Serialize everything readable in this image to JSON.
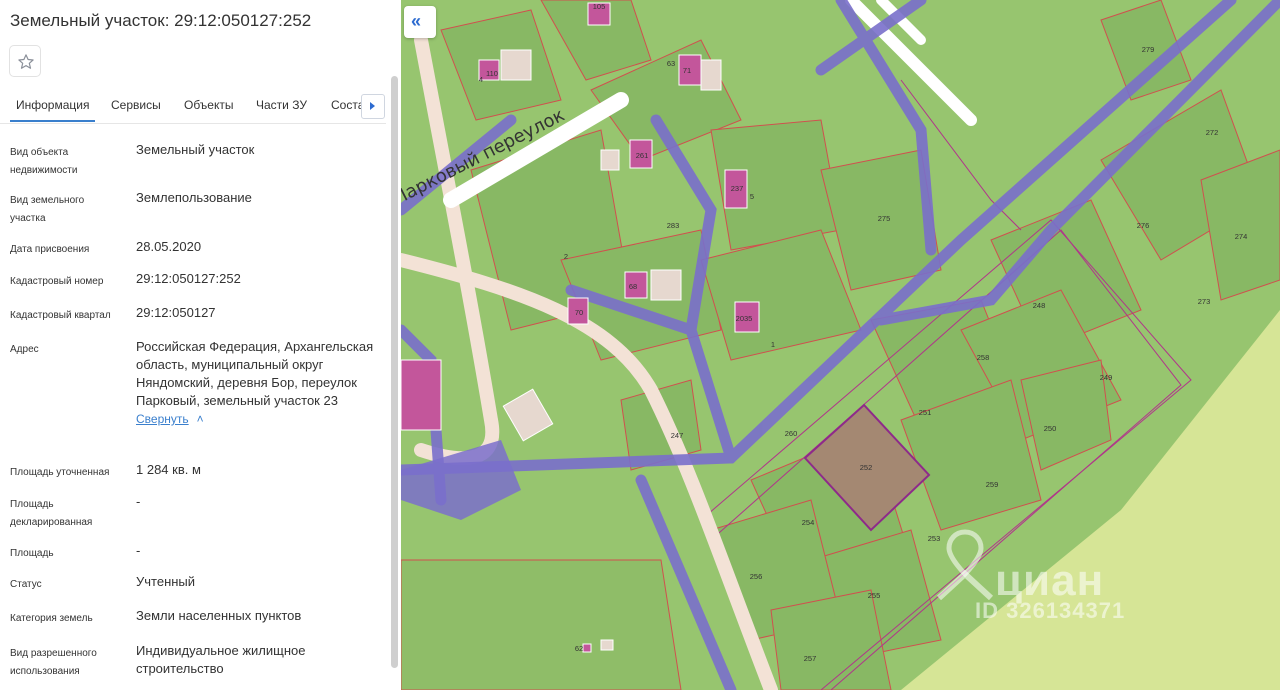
{
  "panel": {
    "title": "Земельный участок: 29:12:050127:252",
    "tabs": [
      "Информация",
      "Сервисы",
      "Объекты",
      "Части ЗУ",
      "Соста"
    ],
    "fields": [
      {
        "label": "Вид объекта недвижимости",
        "value": "Земельный участок"
      },
      {
        "label": "Вид земельного участка",
        "value": "Землепользование"
      },
      {
        "label": "Дата присвоения",
        "value": "28.05.2020"
      },
      {
        "label": "Кадастровый номер",
        "value": "29:12:050127:252"
      },
      {
        "label": "Кадастровый квартал",
        "value": "29:12:050127"
      },
      {
        "label": "Адрес",
        "value": "Российская Федерация, Архангельская область, муниципальный округ Няндомский, деревня Бор, переулок Парковый, земельный участок 23"
      },
      {
        "label": "Площадь уточненная",
        "value": "1 284 кв. м"
      },
      {
        "label": "Площадь декларированная",
        "value": "-"
      },
      {
        "label": "Площадь",
        "value": "-"
      },
      {
        "label": "Статус",
        "value": "Учтенный"
      },
      {
        "label": "Категория земель",
        "value": "Земли населенных пунктов"
      },
      {
        "label": "Вид разрешенного использования",
        "value": "Индивидуальное жилищное строительство"
      }
    ],
    "collapse_link": "Свернуть"
  },
  "map": {
    "street_label": "Парковый переулок",
    "parcel_numbers": [
      "105",
      "110",
      "4",
      "63",
      "71",
      "261",
      "2",
      "237",
      "5",
      "283",
      "279",
      "272",
      "275",
      "276",
      "274",
      "273",
      "68",
      "70",
      "2035",
      "1",
      "248",
      "258",
      "249",
      "251",
      "250",
      "260",
      "247",
      "252",
      "259",
      "254",
      "253",
      "256",
      "255",
      "62",
      "257"
    ],
    "highlighted_parcel": "252",
    "colors": {
      "land": "#97c56f",
      "parcel_fill": "#88b864",
      "parcel_border": "#d0504e",
      "power_line": "#7a6fcb",
      "building": "#c3569b",
      "road": "#f3e2d6",
      "selected_fill": "#a48872",
      "selected_border": "#8e2a8a",
      "field": "#d6e596"
    }
  },
  "watermark": {
    "brand": "циан",
    "id": "ID 326134371"
  },
  "icons": {
    "star": "star-icon",
    "collapse": "double-chevron-left-icon",
    "tab_next": "chevron-right-icon",
    "link_chevron": "chevron-up-icon"
  }
}
